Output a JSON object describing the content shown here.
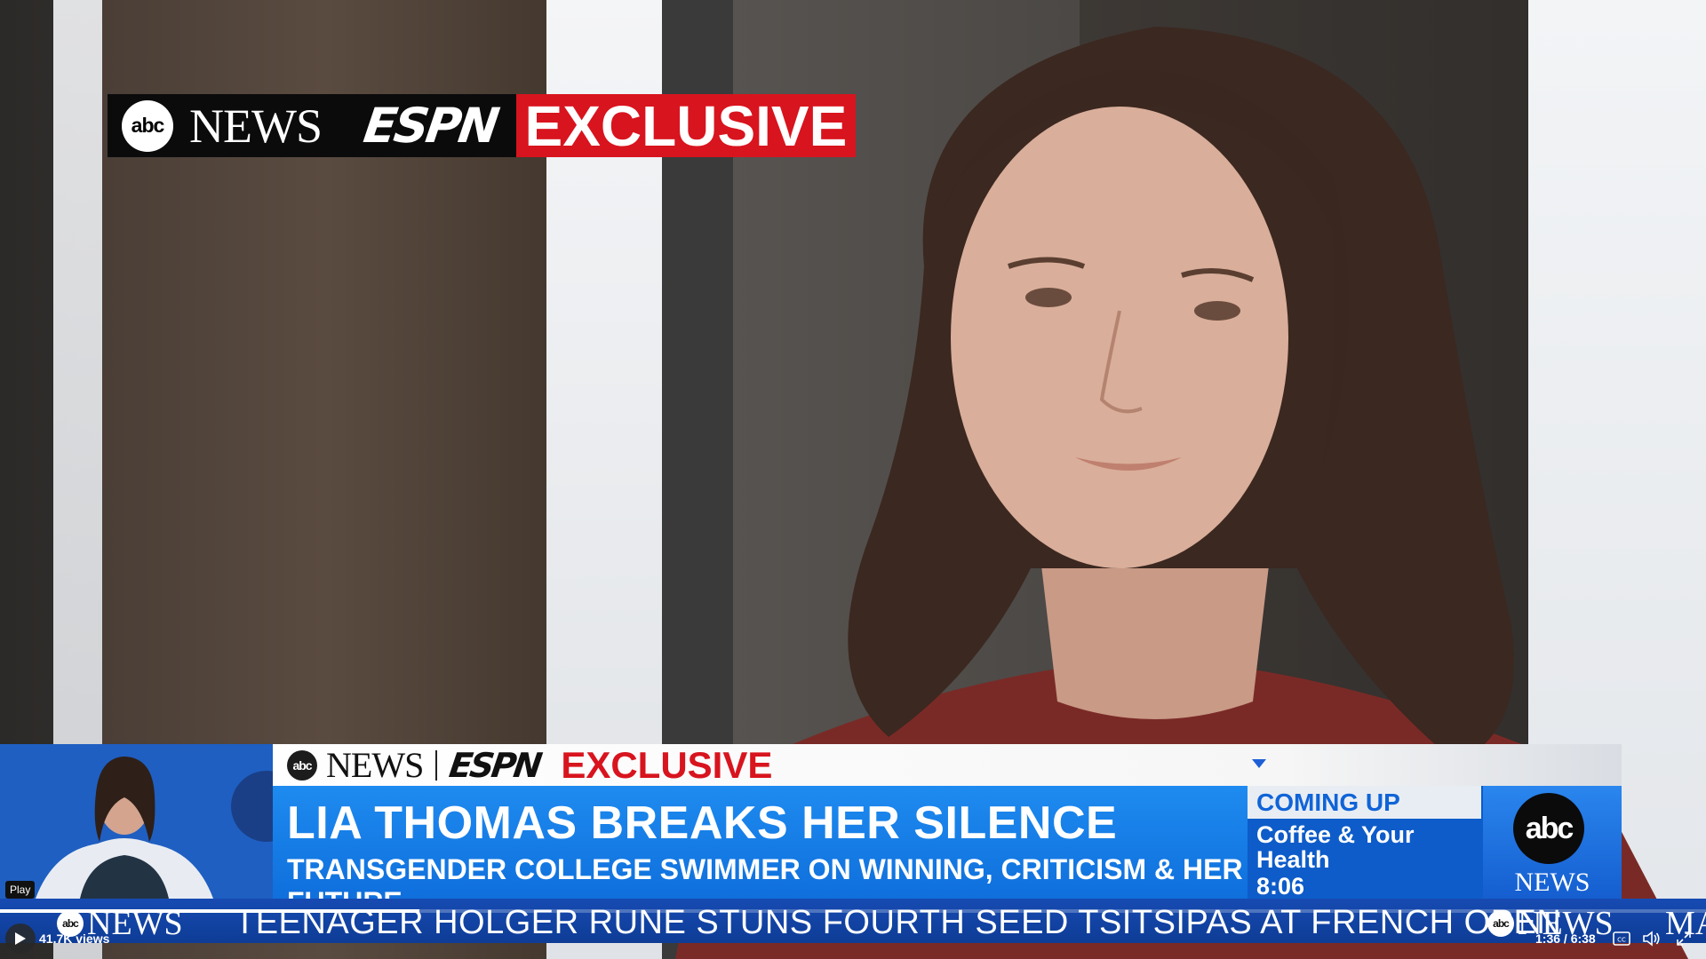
{
  "bug": {
    "abc": "abc",
    "news": "NEWS",
    "espn": "ESPN",
    "exclusive": "EXCLUSIVE"
  },
  "lower_third": {
    "label": {
      "abc": "abc",
      "news": "NEWS",
      "espn": "ESPN",
      "exclusive": "EXCLUSIVE"
    },
    "headline": "LIA THOMAS BREAKS HER SILENCE",
    "subheadline": "TRANSGENDER COLLEGE SWIMMER ON WINNING, CRITICISM & HER FUTURE",
    "coming_up": {
      "heading": "COMING UP",
      "title": "Coffee & Your Health",
      "time": "8:06"
    },
    "network_logo": {
      "abc": "abc",
      "news": "NEWS"
    }
  },
  "ticker": {
    "logo_abc": "abc",
    "logo_news": "NEWS",
    "text": "TEENAGER HOLGER RUNE STUNS FOURTH SEED TSITSIPAS AT FRENCH OPEN",
    "logo2_abc": "abc",
    "logo2_news": "NEWS",
    "trailing": "MA"
  },
  "player": {
    "play_tooltip": "Play",
    "views": "41.7K views",
    "time": "1:36 / 6:38",
    "progress": 0.246,
    "icons": [
      "play-icon",
      "captions-icon",
      "volume-icon",
      "fullscreen-icon"
    ]
  },
  "colors": {
    "red": "#d8141e",
    "blue": "#1e8bf0",
    "dark_blue": "#0e3c96"
  }
}
